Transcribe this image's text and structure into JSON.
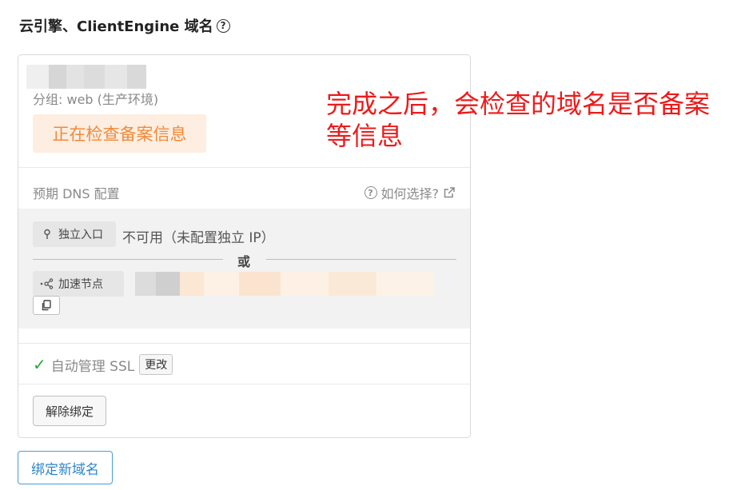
{
  "header": {
    "title": "云引擎、ClientEngine 域名",
    "help_icon": "question-circle-icon"
  },
  "domain_card": {
    "group_label": "分组: web (生产环境)",
    "status_tag": "正在检查备案信息",
    "dns": {
      "title": "预期 DNS 配置",
      "help_link": "如何选择?",
      "dedicated_ip": {
        "chip_label": "独立入口",
        "value": "不可用（未配置独立 IP）"
      },
      "or_label": "或",
      "acceleration": {
        "chip_label": "加速节点"
      }
    },
    "ssl": {
      "label": "自动管理 SSL",
      "change_button": "更改"
    },
    "unbind_button": "解除绑定"
  },
  "bind_new_button": "绑定新域名",
  "annotation": {
    "line1": "完成之后，会检查的域名是否备案",
    "line2": "等信息"
  },
  "colors": {
    "status_orange": "#f08a3c",
    "annotation_red": "#ee1a1a",
    "link_blue": "#2e86c9",
    "ssl_green": "#2aa43a"
  }
}
